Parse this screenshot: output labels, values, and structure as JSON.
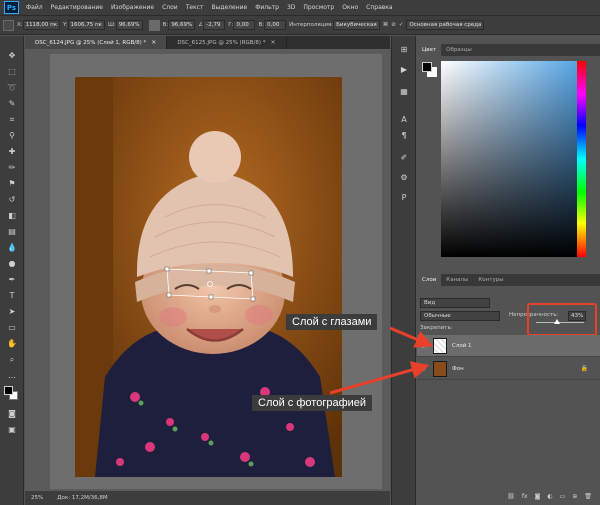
{
  "app": {
    "logo": "Ps",
    "menu": [
      "Файл",
      "Редактирование",
      "Изображение",
      "Слои",
      "Текст",
      "Выделение",
      "Фильтр",
      "3D",
      "Просмотр",
      "Окно",
      "Справка"
    ]
  },
  "options_bar": {
    "x_label": "X:",
    "x_value": "1118,00 пк",
    "y_label": "Y:",
    "y_value": "1606,75 пк",
    "w_label": "Ш:",
    "w_value": "96,69%",
    "h_label": "В:",
    "h_value": "96,69%",
    "angle_value": "-2,79",
    "h_skew_label": "Г:",
    "h_skew_value": "0,00",
    "v_skew_label": "В:",
    "v_skew_value": "0,00",
    "interp_label": "Интерполяция:",
    "interp_value": "Бикубическая",
    "workspace_value": "Основная рабочая среда"
  },
  "tabs": [
    {
      "label": "DSC_6124.JPG @ 25% (Слой 1, RGB/8) *",
      "close": "×"
    },
    {
      "label": "DSC_6125.JPG @ 25% (RGB/8) *",
      "close": "×"
    }
  ],
  "status": {
    "zoom": "25%",
    "doc": "Док: 17,2M/36,8M"
  },
  "color_panel": {
    "tabs": [
      "Цвет",
      "Образцы"
    ]
  },
  "layers_panel": {
    "tabs": [
      "Слои",
      "Каналы",
      "Контуры"
    ],
    "filter_label": "Вид",
    "blend_mode": "Обычные",
    "opacity_label": "Непрозрачность:",
    "opacity_value": "43%",
    "opacity_fraction": 0.43,
    "lock_label": "Закрепить:",
    "layers": [
      {
        "name": "Слой 1",
        "selected": true
      },
      {
        "name": "Фон",
        "selected": false,
        "locked": true
      }
    ]
  },
  "annotations": {
    "eyes_layer": "Слой с глазами",
    "photo_layer": "Слой с фотографией"
  },
  "colors": {
    "highlight": "#e8402a",
    "panel": "#535353",
    "chrome": "#3d3d3d"
  }
}
